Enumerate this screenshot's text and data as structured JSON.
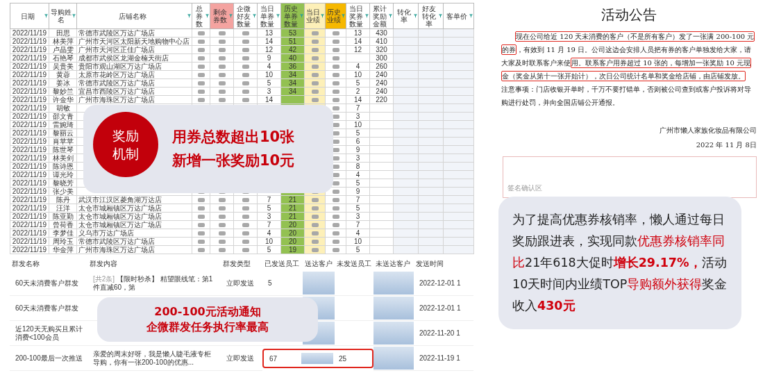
{
  "sheet": {
    "columns": [
      {
        "label": "日期",
        "kind": "value"
      },
      {
        "label": "导购姓名",
        "kind": "value"
      },
      {
        "label": "店铺名称",
        "kind": "wide"
      },
      {
        "label": "总券数",
        "kind": "blurred"
      },
      {
        "label": "剩余券数",
        "kind": "blurred",
        "color": "#f4a3a0"
      },
      {
        "label": "企微好友数量",
        "kind": "blurred"
      },
      {
        "label": "当日单券数量",
        "kind": "value"
      },
      {
        "label": "历史单券数量",
        "kind": "value",
        "color": "#93c152",
        "shaded": true
      },
      {
        "label": "当日业绩",
        "kind": "blurred",
        "color": "#fdf0b8",
        "shaded": true
      },
      {
        "label": "历史业绩",
        "kind": "blurred",
        "color": "#f6b800"
      },
      {
        "label": "当日奖券数量",
        "kind": "value"
      },
      {
        "label": "累计奖励金额",
        "kind": "value"
      },
      {
        "label": "转化率",
        "kind": "empty"
      },
      {
        "label": "好友转化率",
        "kind": "empty"
      },
      {
        "label": "客单价",
        "kind": "empty"
      }
    ],
    "rows": [
      {
        "cells": [
          "2022/11/19",
          "田思",
          "常德市武陵区万达广场店",
          null,
          null,
          null,
          "13",
          "53",
          null,
          null,
          "13",
          "430",
          null,
          null,
          null
        ]
      },
      {
        "cells": [
          "2022/11/19",
          "林美萍",
          "广州市天河区太阳新天地购物中心店",
          null,
          null,
          null,
          "14",
          "51",
          null,
          null,
          "14",
          "410",
          null,
          null,
          null
        ]
      },
      {
        "cells": [
          "2022/11/19",
          "卢晶雯",
          "广州市天河区正佳广场店",
          null,
          null,
          null,
          "12",
          "42",
          null,
          null,
          "12",
          "320",
          null,
          null,
          null
        ]
      },
      {
        "cells": [
          "2022/11/19",
          "石艳琴",
          "成都市武侯区龙湖金楠天街店",
          null,
          null,
          null,
          "9",
          "40",
          null,
          null,
          null,
          "300",
          null,
          null,
          null
        ]
      },
      {
        "cells": [
          "2022/11/19",
          "吴贵美",
          "贵阳市观山湖区万达广场店",
          null,
          null,
          null,
          "4",
          "36",
          null,
          null,
          "4",
          "260",
          null,
          null,
          null
        ]
      },
      {
        "cells": [
          "2022/11/19",
          "黄蓉",
          "太原市花岭区万达广场店",
          null,
          null,
          null,
          "10",
          "34",
          null,
          null,
          "10",
          "240",
          null,
          null,
          null
        ]
      },
      {
        "cells": [
          "2022/11/19",
          "姜冰",
          "常德市武陵区万达广场店",
          null,
          null,
          null,
          "5",
          "34",
          null,
          null,
          "5",
          "240",
          null,
          null,
          null
        ]
      },
      {
        "cells": [
          "2022/11/19",
          "黎妙兰",
          "宜昌市西陵区万达广场店",
          null,
          null,
          null,
          "3",
          "34",
          null,
          null,
          "2",
          "240",
          null,
          null,
          null
        ]
      },
      {
        "cells": [
          "2022/11/19",
          "许金华",
          "广州市海珠区万达广场店",
          null,
          null,
          null,
          "14",
          null,
          null,
          null,
          "14",
          "220",
          null,
          null,
          null
        ]
      },
      {
        "cells": [
          "2022/11/19",
          "胡敏",
          null,
          null,
          null,
          null,
          null,
          null,
          null,
          null,
          "7",
          null,
          null,
          null,
          null
        ]
      },
      {
        "cells": [
          "2022/11/19",
          "邵文青",
          null,
          null,
          null,
          null,
          null,
          null,
          null,
          null,
          "3",
          null,
          null,
          null,
          null
        ]
      },
      {
        "cells": [
          "2022/11/19",
          "雷婉琦",
          null,
          null,
          null,
          null,
          null,
          null,
          null,
          null,
          "10",
          null,
          null,
          null,
          null
        ]
      },
      {
        "cells": [
          "2022/11/19",
          "黎丽云",
          null,
          null,
          null,
          null,
          null,
          null,
          null,
          null,
          "5",
          null,
          null,
          null,
          null
        ]
      },
      {
        "cells": [
          "2022/11/19",
          "肖苹苹",
          null,
          null,
          null,
          null,
          null,
          null,
          null,
          null,
          "6",
          null,
          null,
          null,
          null
        ]
      },
      {
        "cells": [
          "2022/11/19",
          "陈世琴",
          null,
          null,
          null,
          null,
          null,
          null,
          null,
          null,
          "9",
          null,
          null,
          null,
          null
        ]
      },
      {
        "cells": [
          "2022/11/19",
          "林美剑",
          null,
          null,
          null,
          null,
          null,
          null,
          null,
          null,
          "3",
          null,
          null,
          null,
          null
        ]
      },
      {
        "cells": [
          "2022/11/19",
          "陈诗恩",
          null,
          null,
          null,
          null,
          null,
          null,
          null,
          null,
          "8",
          null,
          null,
          null,
          null
        ]
      },
      {
        "cells": [
          "2022/11/19",
          "谭光玲",
          null,
          null,
          null,
          null,
          null,
          null,
          null,
          null,
          "4",
          null,
          null,
          null,
          null
        ]
      },
      {
        "cells": [
          "2022/11/19",
          "黎晓芳",
          null,
          null,
          null,
          null,
          null,
          null,
          null,
          null,
          "5",
          null,
          null,
          null,
          null
        ]
      },
      {
        "cells": [
          "2022/11/19",
          "张少美",
          null,
          null,
          null,
          null,
          null,
          null,
          null,
          null,
          "9",
          null,
          null,
          null,
          null
        ]
      },
      {
        "cells": [
          "2022/11/19",
          "陈丹",
          "武汉市江汉区菱角湖万达店",
          null,
          null,
          null,
          "7",
          "21",
          null,
          null,
          "7",
          null,
          null,
          null,
          null
        ]
      },
      {
        "cells": [
          "2022/11/19",
          "汪洋",
          "太仓市城厢镇区万达广场店",
          null,
          null,
          null,
          "5",
          "21",
          null,
          null,
          "5",
          null,
          null,
          null,
          null
        ]
      },
      {
        "cells": [
          "2022/11/19",
          "陈亚勤",
          "太仓市城厢镇区万达广场店",
          null,
          null,
          null,
          "3",
          "21",
          null,
          null,
          "3",
          null,
          null,
          null,
          null
        ]
      },
      {
        "cells": [
          "2022/11/19",
          "曾荷香",
          "太仓市城厢镇区万达广场店",
          null,
          null,
          null,
          "7",
          "20",
          null,
          null,
          "7",
          null,
          null,
          null,
          null
        ]
      },
      {
        "cells": [
          "2022/11/19",
          "李梦佳",
          "义乌市万达广场店",
          null,
          null,
          null,
          "4",
          "20",
          null,
          null,
          "4",
          null,
          null,
          null,
          null
        ]
      },
      {
        "cells": [
          "2022/11/19",
          "周玲玉",
          "常德市武陵区万达广场店",
          null,
          null,
          null,
          "10",
          "20",
          null,
          null,
          "10",
          null,
          null,
          null,
          null
        ]
      },
      {
        "cells": [
          "2022/11/19",
          "华金萍",
          "广州市海珠区万达广场店",
          null,
          null,
          null,
          "5",
          "19",
          null,
          null,
          "5",
          null,
          null,
          null,
          null
        ]
      }
    ]
  },
  "reward_card": {
    "badge": [
      "奖励",
      "机制"
    ],
    "lines": [
      "用券总数超出10张",
      "新增一张奖励10元"
    ]
  },
  "broadcast": {
    "columns": [
      {
        "label": "群发名称",
        "kind": "name"
      },
      {
        "label": "群发内容",
        "kind": "content"
      },
      {
        "label": "群发类型",
        "kind": "type"
      },
      {
        "label": "已发送员工",
        "kind": "sent"
      },
      {
        "label": "送达客户",
        "kind": "blurred"
      },
      {
        "label": "未发送员工",
        "kind": "unsent"
      },
      {
        "label": "未送达客户",
        "kind": "blurred"
      },
      {
        "label": "发送时间",
        "kind": "time"
      }
    ],
    "rows": [
      {
        "name": "60天未消费客户群发",
        "count": "[共2条]",
        "content": "【限时秒杀】 精望眼线笔：第1件直减60，第",
        "type": "立即发送",
        "sent": "5",
        "time": "2022-12-01 1",
        "highlight": false
      },
      {
        "name": "60天未消费客户群发",
        "time": "2022-12-01 1",
        "highlight": false
      },
      {
        "name": "近120天无购买且累计消费<100会员",
        "time": "2022-11-20 1",
        "highlight": false
      },
      {
        "name": "200-100最后一次推送",
        "content": "亲爱的周末好呀，我是懒人睫毛液专柜导购，你有一张200-100的优惠...",
        "type": "立即发送",
        "sent": "67",
        "unsent": "25",
        "time": "2022-11-19 1",
        "highlight": true
      }
    ]
  },
  "notice_card": {
    "lines": [
      "200-100元活动通知",
      "企微群发任务执行率最高"
    ]
  },
  "announcement": {
    "title": "活动公告",
    "paragraph": [
      {
        "text": "现在公司给近 120 天未消费的客户（不是所有客户）发了一张满 200-100 元的券",
        "highlight": true
      },
      {
        "text": "，有效到 11 月 19 日。公司这边会安排人员把有券的客户单独发给大家，请大家及时联系客户来使",
        "highlight": false
      },
      {
        "text": "用。联系客户用券超过 10 张的，每增加一张奖励 10 元现金（奖金从第十一张开始计），次日公司统计名单和奖金给店铺，由店铺发放。",
        "highlight": true
      }
    ],
    "note": "注意事项：门店收银开单时，千万不要打错单，否则被公司查到或客户投诉将对导购进行处罚，并向全国店铺公开通报。",
    "company": "广州市懒人家族化妆品有限公司",
    "date": "2022 年 11 月 8日"
  },
  "signature": {
    "label": "签名确认区"
  },
  "summary": [
    {
      "text": "为了提高优惠券核销率，懒人通过每日奖励跟进表，实现同款",
      "highlight": false,
      "bold": false
    },
    {
      "text": "优惠券核销率同比",
      "highlight": true,
      "bold": false
    },
    {
      "text": "21年618大促时",
      "highlight": false,
      "bold": false
    },
    {
      "text": "增长29.17%，",
      "highlight": true,
      "bold": true
    },
    {
      "text": "活动10天时间内业绩TOP",
      "highlight": false,
      "bold": false
    },
    {
      "text": "导购额外获得",
      "highlight": true,
      "bold": false
    },
    {
      "text": "奖金收入",
      "highlight": false,
      "bold": false
    },
    {
      "text": "430元",
      "highlight": true,
      "bold": true
    }
  ]
}
